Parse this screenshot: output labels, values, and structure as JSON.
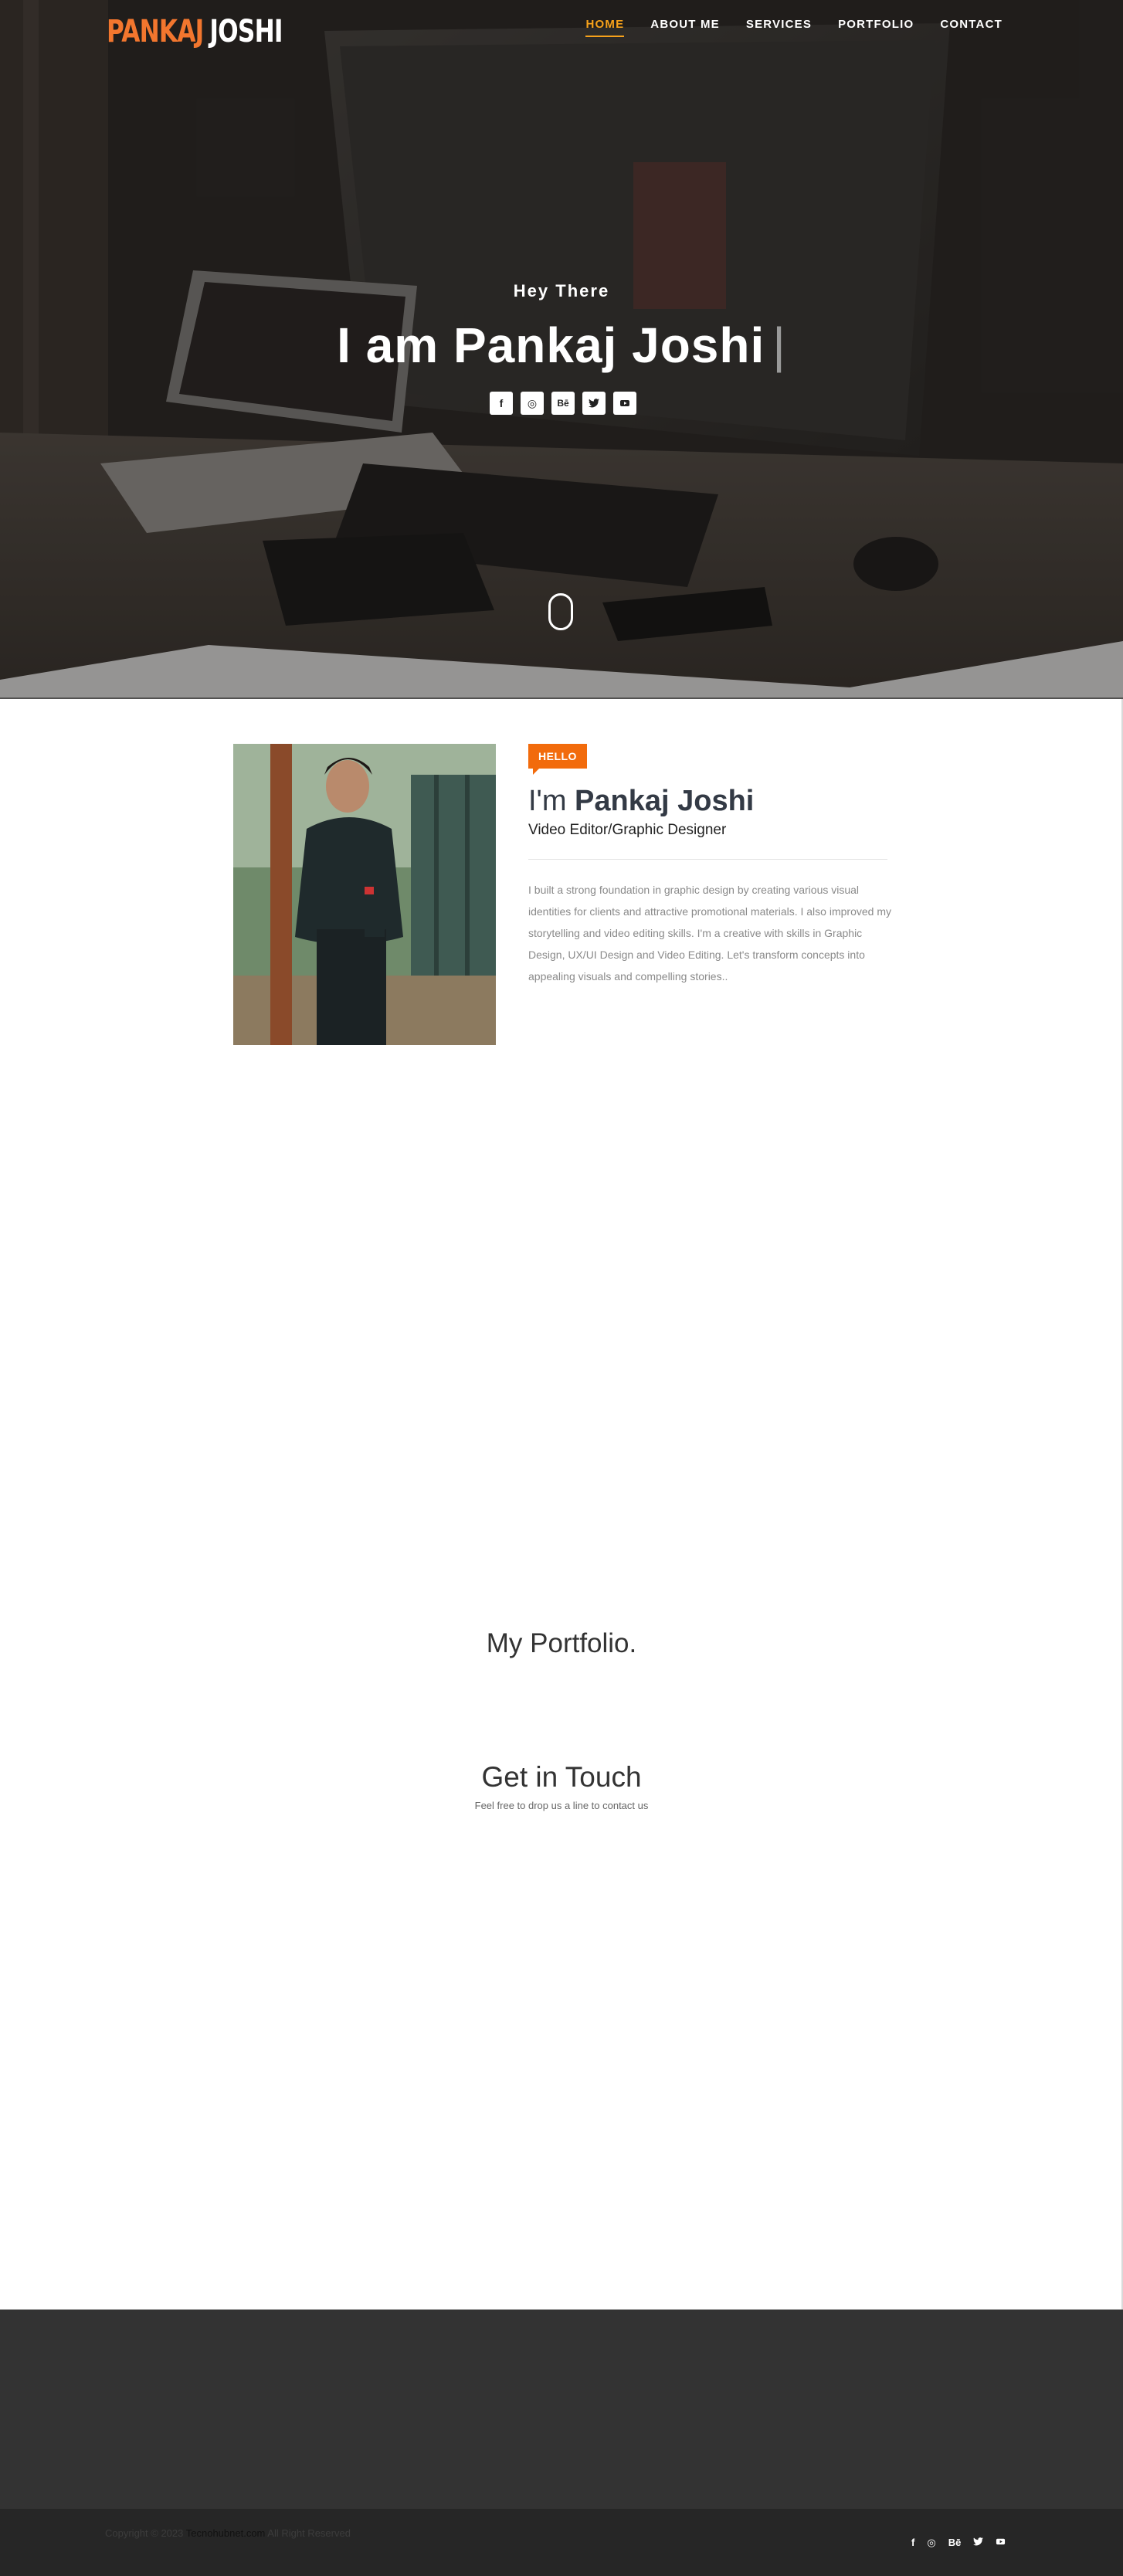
{
  "brand": {
    "first": "PANKAJ",
    "last": "JOSHI"
  },
  "nav": [
    {
      "label": "HOME",
      "active": true
    },
    {
      "label": "ABOUT ME",
      "active": false
    },
    {
      "label": "SERVICES",
      "active": false
    },
    {
      "label": "PORTFOLIO",
      "active": false
    },
    {
      "label": "CONTACT",
      "active": false
    }
  ],
  "hero": {
    "subtitle": "Hey There",
    "title": "I am Pankaj Joshi",
    "cursor": "|",
    "social": [
      {
        "icon": "facebook-icon",
        "glyph": "f"
      },
      {
        "icon": "instagram-icon",
        "glyph": "◎"
      },
      {
        "icon": "behance-icon",
        "glyph": "Bē"
      },
      {
        "icon": "twitter-icon",
        "glyph": "🐦"
      },
      {
        "icon": "youtube-icon",
        "glyph": "▶"
      }
    ]
  },
  "about": {
    "tag": "HELLO",
    "name_prefix": "I'm",
    "name": "Pankaj Joshi",
    "role": "Video Editor/Graphic Designer",
    "bio": "I built a strong foundation in graphic design by creating various visual identities for clients and attractive promotional materials. I also improved my storytelling and video editing skills. I'm a creative with skills in Graphic Design, UX/UI Design and Video Editing. Let's transform concepts into appealing visuals and compelling stories.."
  },
  "portfolio": {
    "title": "My Portfolio."
  },
  "contact": {
    "title": "Get in Touch",
    "subtitle": "Feel free to drop us a line to contact us"
  },
  "footer": {
    "copyright_prefix": "Copyright © 2023",
    "copyright_link": "Tecnohubnet.com",
    "copyright_suffix": "All Right Reserved",
    "social": [
      {
        "icon": "facebook-icon",
        "glyph": "f"
      },
      {
        "icon": "instagram-icon",
        "glyph": "◎"
      },
      {
        "icon": "behance-icon",
        "glyph": "Bē"
      },
      {
        "icon": "twitter-icon",
        "glyph": "🐦"
      },
      {
        "icon": "youtube-icon",
        "glyph": "▶"
      }
    ]
  },
  "colors": {
    "accent": "#f2762e",
    "nav_active": "#f7a21b",
    "tag": "#f26b0c",
    "footer": "#333333",
    "footer_bottom": "#262626"
  }
}
